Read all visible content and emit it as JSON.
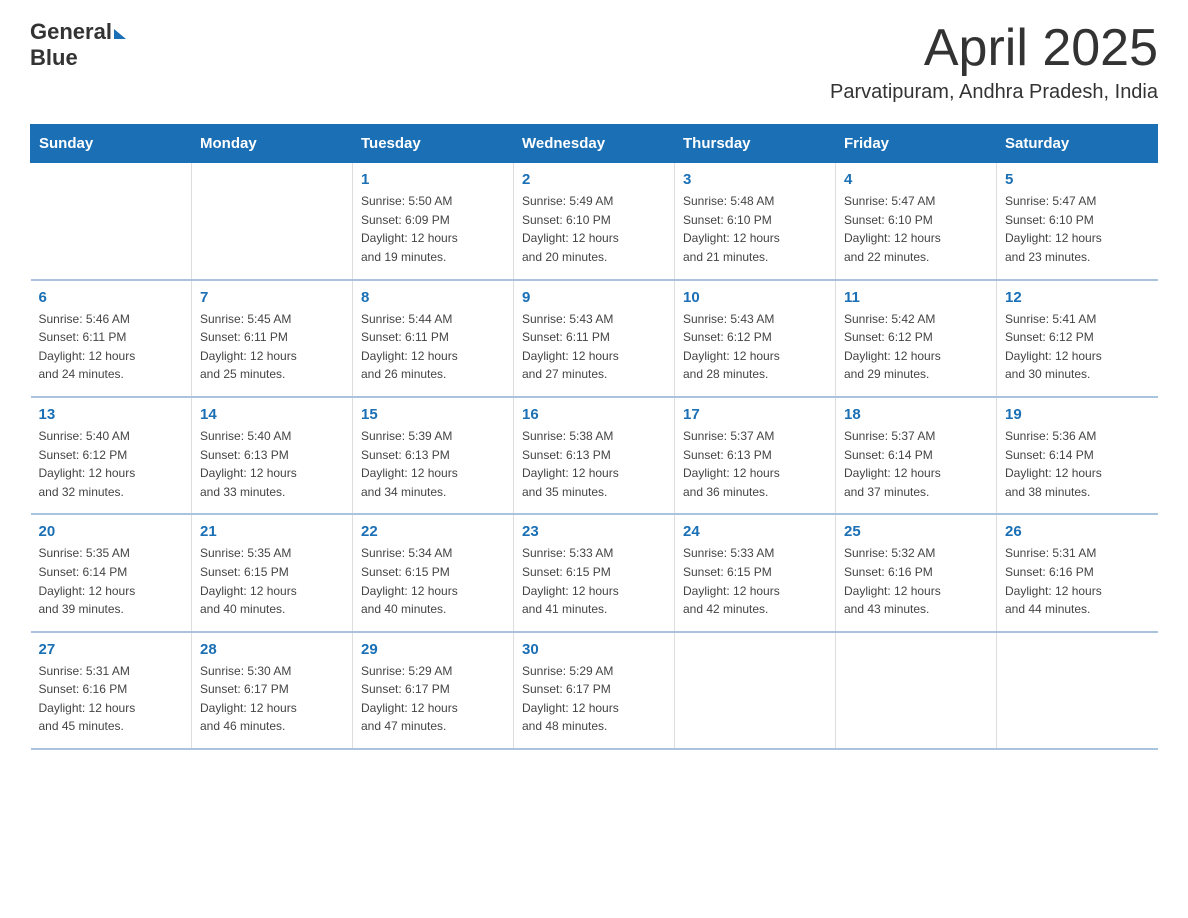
{
  "header": {
    "logo_text_general": "General",
    "logo_text_blue": "Blue",
    "month_title": "April 2025",
    "location": "Parvatipuram, Andhra Pradesh, India"
  },
  "weekdays": [
    "Sunday",
    "Monday",
    "Tuesday",
    "Wednesday",
    "Thursday",
    "Friday",
    "Saturday"
  ],
  "weeks": [
    [
      {
        "day": "",
        "info": ""
      },
      {
        "day": "",
        "info": ""
      },
      {
        "day": "1",
        "info": "Sunrise: 5:50 AM\nSunset: 6:09 PM\nDaylight: 12 hours\nand 19 minutes."
      },
      {
        "day": "2",
        "info": "Sunrise: 5:49 AM\nSunset: 6:10 PM\nDaylight: 12 hours\nand 20 minutes."
      },
      {
        "day": "3",
        "info": "Sunrise: 5:48 AM\nSunset: 6:10 PM\nDaylight: 12 hours\nand 21 minutes."
      },
      {
        "day": "4",
        "info": "Sunrise: 5:47 AM\nSunset: 6:10 PM\nDaylight: 12 hours\nand 22 minutes."
      },
      {
        "day": "5",
        "info": "Sunrise: 5:47 AM\nSunset: 6:10 PM\nDaylight: 12 hours\nand 23 minutes."
      }
    ],
    [
      {
        "day": "6",
        "info": "Sunrise: 5:46 AM\nSunset: 6:11 PM\nDaylight: 12 hours\nand 24 minutes."
      },
      {
        "day": "7",
        "info": "Sunrise: 5:45 AM\nSunset: 6:11 PM\nDaylight: 12 hours\nand 25 minutes."
      },
      {
        "day": "8",
        "info": "Sunrise: 5:44 AM\nSunset: 6:11 PM\nDaylight: 12 hours\nand 26 minutes."
      },
      {
        "day": "9",
        "info": "Sunrise: 5:43 AM\nSunset: 6:11 PM\nDaylight: 12 hours\nand 27 minutes."
      },
      {
        "day": "10",
        "info": "Sunrise: 5:43 AM\nSunset: 6:12 PM\nDaylight: 12 hours\nand 28 minutes."
      },
      {
        "day": "11",
        "info": "Sunrise: 5:42 AM\nSunset: 6:12 PM\nDaylight: 12 hours\nand 29 minutes."
      },
      {
        "day": "12",
        "info": "Sunrise: 5:41 AM\nSunset: 6:12 PM\nDaylight: 12 hours\nand 30 minutes."
      }
    ],
    [
      {
        "day": "13",
        "info": "Sunrise: 5:40 AM\nSunset: 6:12 PM\nDaylight: 12 hours\nand 32 minutes."
      },
      {
        "day": "14",
        "info": "Sunrise: 5:40 AM\nSunset: 6:13 PM\nDaylight: 12 hours\nand 33 minutes."
      },
      {
        "day": "15",
        "info": "Sunrise: 5:39 AM\nSunset: 6:13 PM\nDaylight: 12 hours\nand 34 minutes."
      },
      {
        "day": "16",
        "info": "Sunrise: 5:38 AM\nSunset: 6:13 PM\nDaylight: 12 hours\nand 35 minutes."
      },
      {
        "day": "17",
        "info": "Sunrise: 5:37 AM\nSunset: 6:13 PM\nDaylight: 12 hours\nand 36 minutes."
      },
      {
        "day": "18",
        "info": "Sunrise: 5:37 AM\nSunset: 6:14 PM\nDaylight: 12 hours\nand 37 minutes."
      },
      {
        "day": "19",
        "info": "Sunrise: 5:36 AM\nSunset: 6:14 PM\nDaylight: 12 hours\nand 38 minutes."
      }
    ],
    [
      {
        "day": "20",
        "info": "Sunrise: 5:35 AM\nSunset: 6:14 PM\nDaylight: 12 hours\nand 39 minutes."
      },
      {
        "day": "21",
        "info": "Sunrise: 5:35 AM\nSunset: 6:15 PM\nDaylight: 12 hours\nand 40 minutes."
      },
      {
        "day": "22",
        "info": "Sunrise: 5:34 AM\nSunset: 6:15 PM\nDaylight: 12 hours\nand 40 minutes."
      },
      {
        "day": "23",
        "info": "Sunrise: 5:33 AM\nSunset: 6:15 PM\nDaylight: 12 hours\nand 41 minutes."
      },
      {
        "day": "24",
        "info": "Sunrise: 5:33 AM\nSunset: 6:15 PM\nDaylight: 12 hours\nand 42 minutes."
      },
      {
        "day": "25",
        "info": "Sunrise: 5:32 AM\nSunset: 6:16 PM\nDaylight: 12 hours\nand 43 minutes."
      },
      {
        "day": "26",
        "info": "Sunrise: 5:31 AM\nSunset: 6:16 PM\nDaylight: 12 hours\nand 44 minutes."
      }
    ],
    [
      {
        "day": "27",
        "info": "Sunrise: 5:31 AM\nSunset: 6:16 PM\nDaylight: 12 hours\nand 45 minutes."
      },
      {
        "day": "28",
        "info": "Sunrise: 5:30 AM\nSunset: 6:17 PM\nDaylight: 12 hours\nand 46 minutes."
      },
      {
        "day": "29",
        "info": "Sunrise: 5:29 AM\nSunset: 6:17 PM\nDaylight: 12 hours\nand 47 minutes."
      },
      {
        "day": "30",
        "info": "Sunrise: 5:29 AM\nSunset: 6:17 PM\nDaylight: 12 hours\nand 48 minutes."
      },
      {
        "day": "",
        "info": ""
      },
      {
        "day": "",
        "info": ""
      },
      {
        "day": "",
        "info": ""
      }
    ]
  ]
}
